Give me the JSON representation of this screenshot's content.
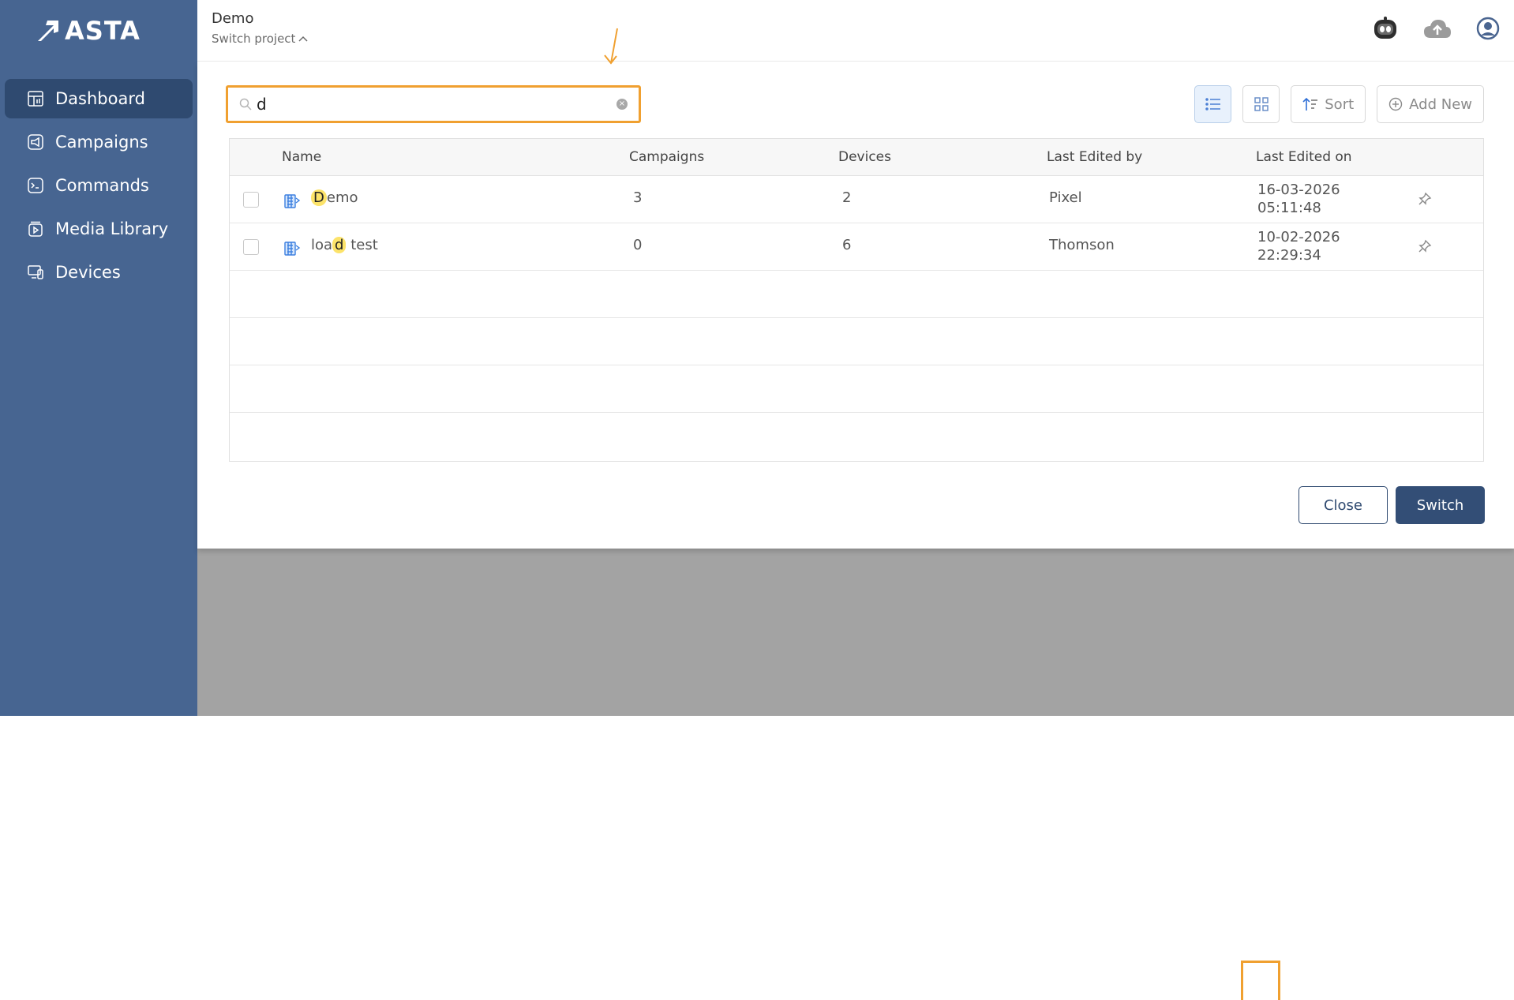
{
  "app": {
    "logo_text": "ASTA"
  },
  "sidebar": {
    "items": [
      {
        "label": "Dashboard",
        "icon": "dashboard-icon",
        "active": true
      },
      {
        "label": "Campaigns",
        "icon": "megaphone-icon"
      },
      {
        "label": "Commands",
        "icon": "terminal-icon"
      },
      {
        "label": "Media Library",
        "icon": "media-icon"
      },
      {
        "label": "Devices",
        "icon": "devices-icon"
      }
    ]
  },
  "header": {
    "project_name": "Demo",
    "switch_label": "Switch project",
    "icons": [
      "robot-icon",
      "cloud-upload-icon",
      "user-avatar-icon"
    ]
  },
  "search": {
    "value": "d",
    "placeholder": ""
  },
  "toolbar": {
    "sort_label": "Sort",
    "add_new_label": "Add New"
  },
  "table": {
    "columns": [
      "Name",
      "Campaigns",
      "Devices",
      "Last Edited by",
      "Last Edited on"
    ],
    "rows": [
      {
        "name_pre": "",
        "name_hl": "D",
        "name_post": "emo",
        "campaigns": "3",
        "devices": "2",
        "edited_by": "Pixel",
        "date": "16-03-2026",
        "time": "05:11:48"
      },
      {
        "name_pre": "loa",
        "name_hl": "d",
        "name_post": " test",
        "campaigns": "0",
        "devices": "6",
        "edited_by": "Thomson",
        "date": "10-02-2026",
        "time": "22:29:34"
      }
    ]
  },
  "actions": {
    "close_label": "Close",
    "switch_label": "Switch"
  },
  "colors": {
    "sidebar": "#476591",
    "accent": "#334e76",
    "highlight": "#fce36a",
    "focus": "#f0a030"
  }
}
